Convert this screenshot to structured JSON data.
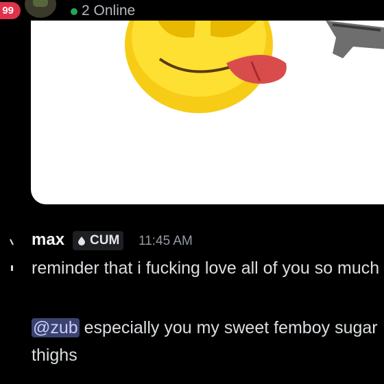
{
  "header": {
    "notification_count": "99",
    "online_status": "2 Online"
  },
  "attachment": {
    "alt": "emoji"
  },
  "message": {
    "author": "max",
    "role_tag": "CUM",
    "timestamp": "11:45 AM",
    "line1": "reminder that i fucking love all of you so much",
    "mention": "@zub",
    "line2_rest": " especially you my sweet femboy sugar thighs"
  },
  "colors": {
    "background": "#000000",
    "mention_bg": "#3c4270",
    "online_green": "#23a55a",
    "badge_red": "#e0324a"
  }
}
